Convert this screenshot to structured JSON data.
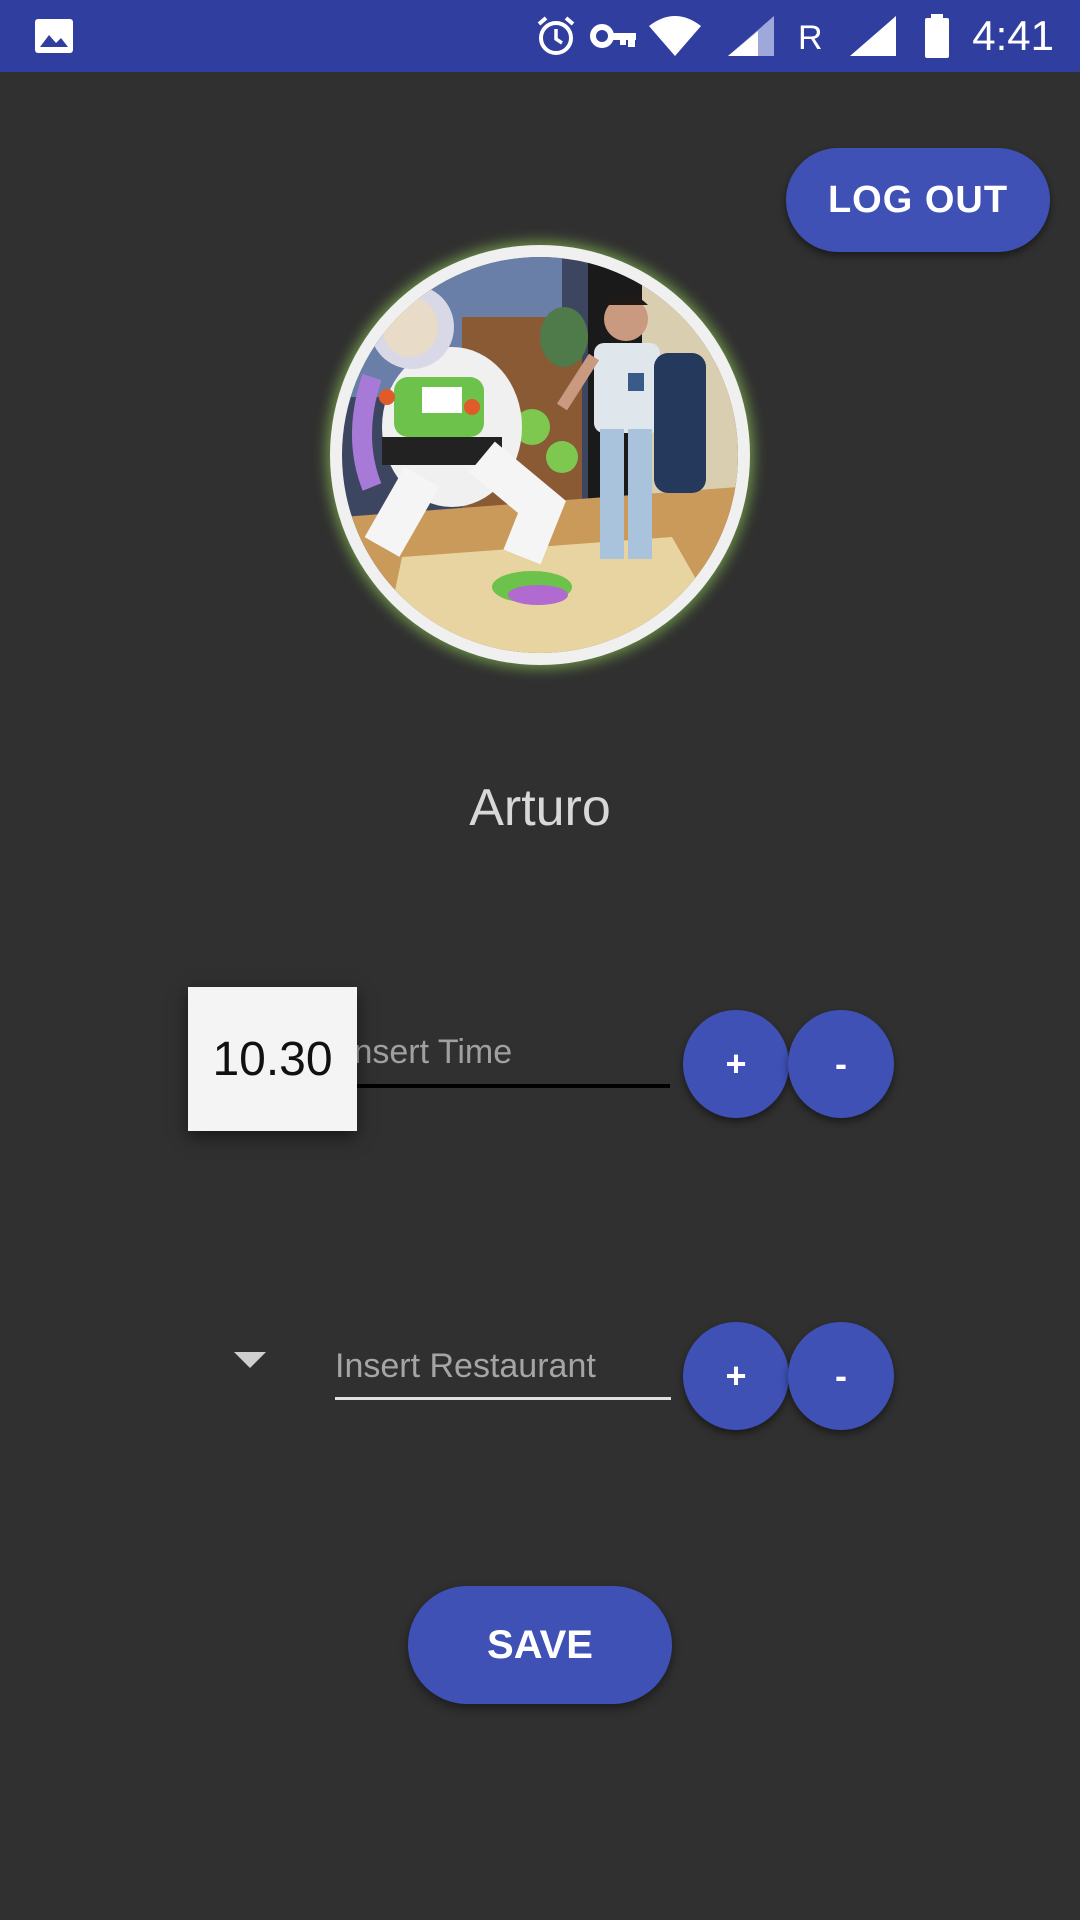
{
  "status_bar": {
    "time": "4:41",
    "network_label": "R",
    "icons": [
      "image-icon",
      "alarm-icon",
      "vpn-key-icon",
      "wifi-icon",
      "signal-icon",
      "signal-icon",
      "battery-icon"
    ],
    "background": "#303f9f"
  },
  "header": {
    "logout_label": "LOG OUT"
  },
  "profile": {
    "name": "Arturo"
  },
  "time_row": {
    "time_value": "10.30",
    "input_placeholder": "Insert Time",
    "plus_label": "+",
    "minus_label": "-"
  },
  "restaurant_row": {
    "input_placeholder": "Insert Restaurant",
    "plus_label": "+",
    "minus_label": "-"
  },
  "footer": {
    "save_label": "SAVE"
  },
  "colors": {
    "background": "#303030",
    "accent": "#3f51b5",
    "status_bar": "#303f9f"
  }
}
